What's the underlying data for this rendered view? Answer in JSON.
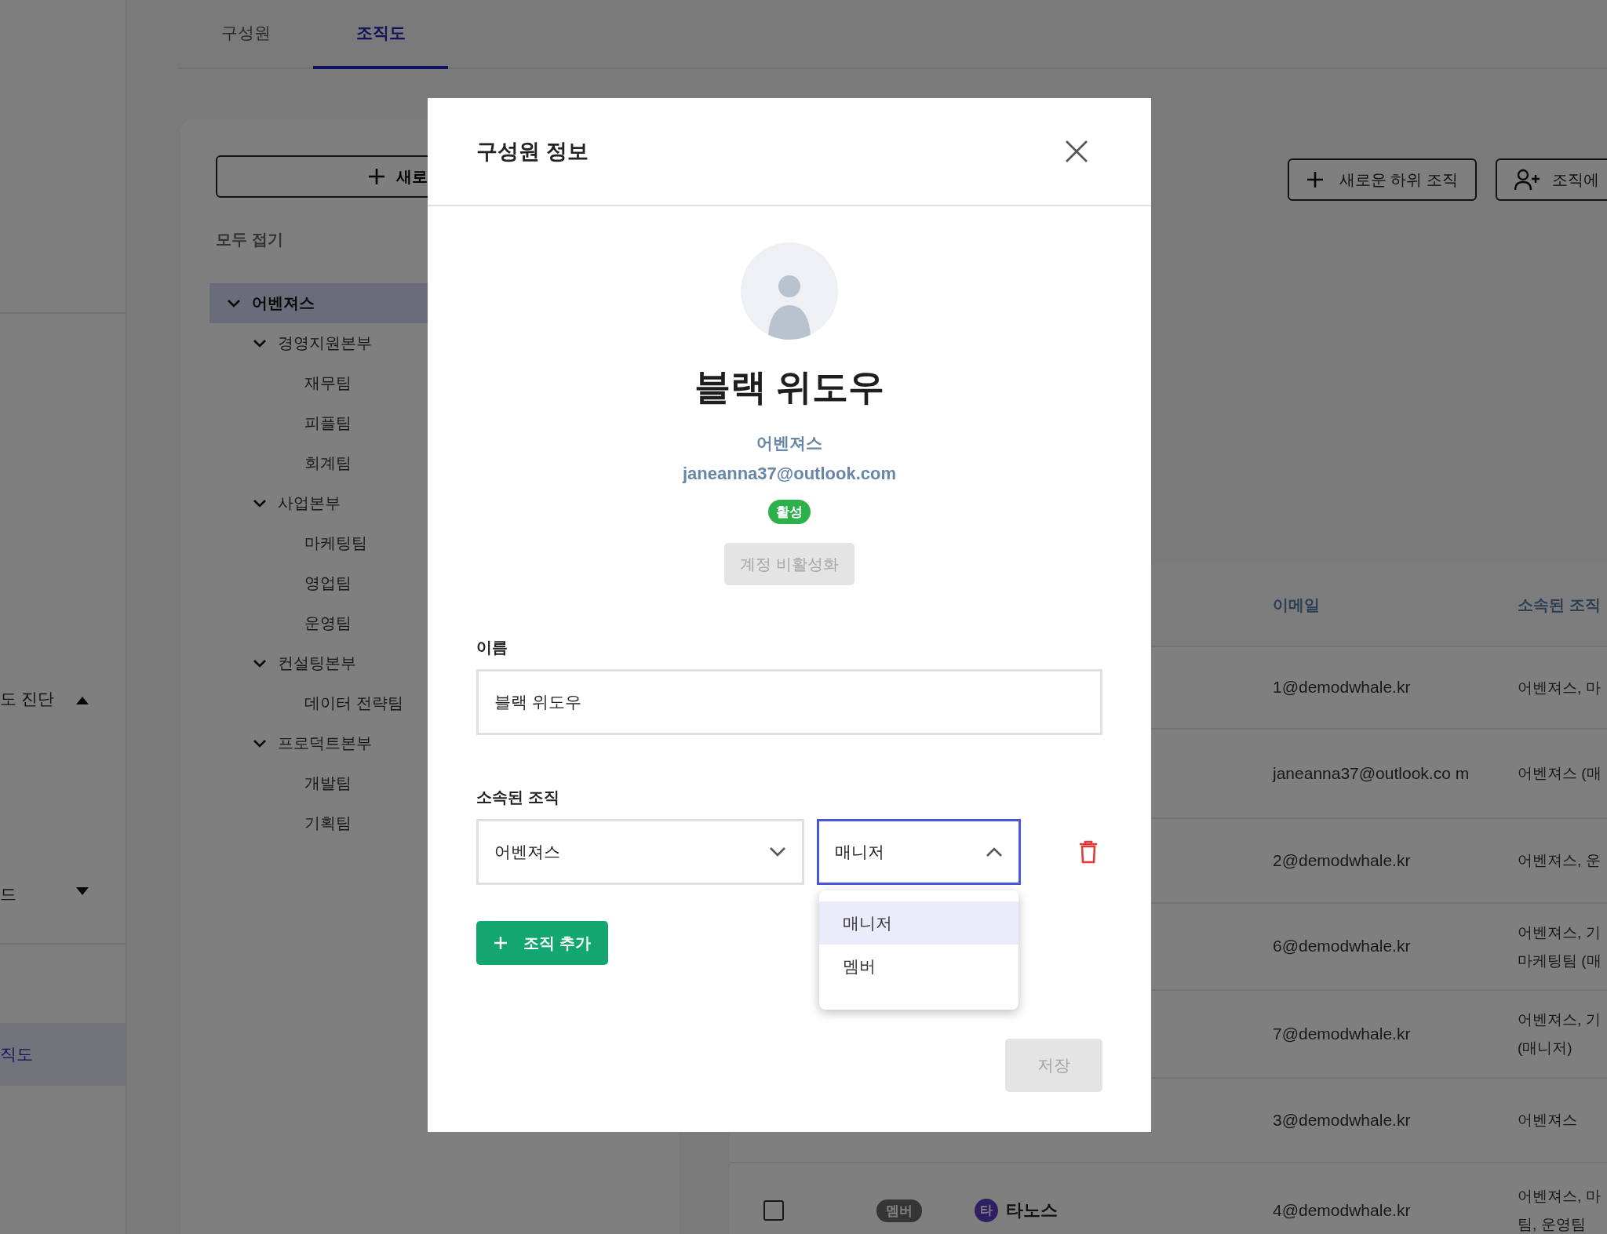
{
  "sidebar": {
    "items": [
      {
        "label": "도 진단",
        "kind": "group",
        "expanded": true,
        "selected": false
      },
      {
        "label": "드",
        "kind": "group",
        "expanded": false,
        "selected": false
      },
      {
        "label": "직도",
        "kind": "link",
        "selected": true
      }
    ]
  },
  "tabs": [
    {
      "label": "구성원",
      "selected": false
    },
    {
      "label": "조직도",
      "selected": true
    }
  ],
  "tree_panel": {
    "new_button": "새로",
    "collapse_all": "모두 접기",
    "tree": [
      {
        "label": "어벤져스",
        "selected": true,
        "expanded": true,
        "children": [
          {
            "label": "경영지원본부",
            "selected": false,
            "expanded": true,
            "children": [
              {
                "label": "재무팀",
                "selected": false
              },
              {
                "label": "피플팀",
                "selected": false
              },
              {
                "label": "회계팀",
                "selected": false
              }
            ]
          },
          {
            "label": "사업본부",
            "selected": false,
            "expanded": true,
            "children": [
              {
                "label": "마케팅팀",
                "selected": false
              },
              {
                "label": "영업팀",
                "selected": false
              },
              {
                "label": "운영팀",
                "selected": false
              }
            ]
          },
          {
            "label": "컨설팅본부",
            "selected": false,
            "expanded": true,
            "children": [
              {
                "label": "데이터 전략팀",
                "selected": false
              }
            ]
          },
          {
            "label": "프로덕트본부",
            "selected": false,
            "expanded": true,
            "children": [
              {
                "label": "개발팀",
                "selected": false
              },
              {
                "label": "기획팀",
                "selected": false
              }
            ]
          }
        ]
      }
    ]
  },
  "toolbar": {
    "buttons": [
      {
        "label": "새로운 하위 조직",
        "kind": "add"
      },
      {
        "label": "조직에",
        "kind": "invite"
      }
    ]
  },
  "table": {
    "columns": [
      "이메일",
      "소속된 조직"
    ],
    "rows": [
      {
        "email": "1@demodwhale.kr",
        "organization_lines": [
          "어벤져스, 마"
        ]
      },
      {
        "email": "janeanna37@outlook.co m",
        "organization_lines": [
          "어벤져스 (매"
        ]
      },
      {
        "email": "2@demodwhale.kr",
        "organization_lines": [
          "어벤져스, 운"
        ]
      },
      {
        "email": "6@demodwhale.kr",
        "organization_lines": [
          "어벤져스, 기",
          "마케팅팀 (매"
        ]
      },
      {
        "email": "7@demodwhale.kr",
        "organization_lines": [
          "어벤져스, 기",
          "(매니저)"
        ]
      },
      {
        "email": "3@demodwhale.kr",
        "organization_lines": [
          "어벤져스"
        ]
      },
      {
        "checked": false,
        "role": "멤버",
        "avatar_initial": "타",
        "name": "타노스",
        "email": "4@demodwhale.kr",
        "organization_lines": [
          "어벤져스, 마",
          "팀, 운영팀"
        ]
      }
    ]
  },
  "modal": {
    "title": "구성원 정보",
    "profile": {
      "name": "블랙 위도우",
      "organization": "어벤져스",
      "email": "janeanna37@outlook.com",
      "status": "활성",
      "deactivate_button": {
        "label": "계정 비활성화",
        "disabled": true
      }
    },
    "name_label": "이름",
    "name_value": "블랙 위도우",
    "membership_label": "소속된 조직",
    "memberships": [
      {
        "organization": "어벤져스",
        "organization_open": false,
        "role": "매니저",
        "role_open": true
      }
    ],
    "role_options": [
      {
        "label": "매니저",
        "selected": true
      },
      {
        "label": "멤버",
        "selected": false
      }
    ],
    "add_button": "조직 추가",
    "save_button": {
      "label": "저장",
      "disabled": true
    }
  }
}
